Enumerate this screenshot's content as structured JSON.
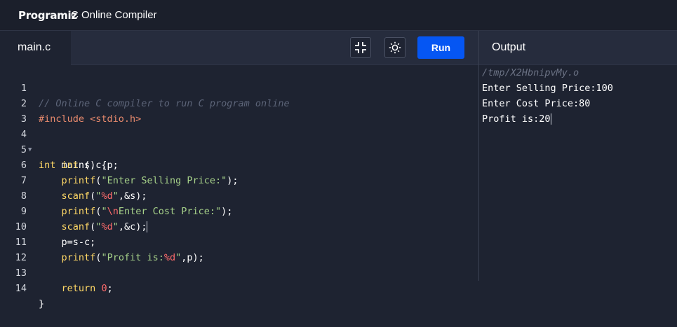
{
  "header": {
    "logo_text": "Programiz",
    "title": "C Online Compiler"
  },
  "toolbar": {
    "file_tab": "main.c",
    "icons": [
      "exit-fullscreen-icon",
      "theme-toggle-icon"
    ],
    "run_label": "Run",
    "output_label": "Output"
  },
  "editor": {
    "lines": [
      {
        "n": "1",
        "text": "// Online C compiler to run C program online"
      },
      {
        "n": "2",
        "text": "#include <stdio.h>"
      },
      {
        "n": "3",
        "text": ""
      },
      {
        "n": "4",
        "text": "int main() {"
      },
      {
        "n": "5",
        "text": "    int s,c,p;"
      },
      {
        "n": "6",
        "text": "    printf(\"Enter Selling Price:\");"
      },
      {
        "n": "7",
        "text": "    scanf(\"%d\",&s);"
      },
      {
        "n": "8",
        "text": "    printf(\"\\nEnter Cost Price:\");"
      },
      {
        "n": "9",
        "text": "    scanf(\"%d\",&c);"
      },
      {
        "n": "10",
        "text": "    p=s-c;"
      },
      {
        "n": "11",
        "text": "    printf(\"Profit is:%d\",p);"
      },
      {
        "n": "12",
        "text": ""
      },
      {
        "n": "13",
        "text": "    return 0;"
      },
      {
        "n": "14",
        "text": "}"
      }
    ]
  },
  "output": {
    "path": "/tmp/X2HbnipvMy.o",
    "lines": [
      "Enter Selling Price:100",
      "Enter Cost Price:80",
      "Profit is:20"
    ]
  },
  "colors": {
    "run_button": "#0556f3",
    "background": "#1e2331"
  }
}
